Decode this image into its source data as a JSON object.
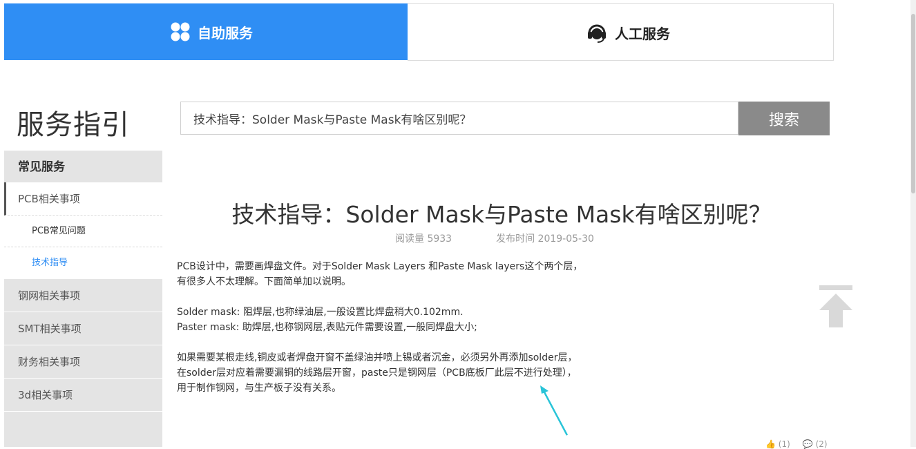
{
  "tabs": {
    "self_service": "自助服务",
    "human_service": "人工服务"
  },
  "sidebar": {
    "guide_title": "服务指引",
    "header": "常见服务",
    "items": [
      {
        "label": "PCB相关事项",
        "active": true
      },
      {
        "label": "PCB常见问题",
        "sub": true
      },
      {
        "label": "技术指导",
        "sub": true,
        "current": true
      },
      {
        "label": "钢网相关事项"
      },
      {
        "label": "SMT相关事项"
      },
      {
        "label": "财务相关事项"
      },
      {
        "label": "3d相关事项"
      }
    ]
  },
  "search": {
    "value": "技术指导：Solder Mask与Paste Mask有啥区别呢？",
    "button_label": "搜索"
  },
  "article": {
    "title": "技术指导：Solder Mask与Paste Mask有啥区别呢？",
    "views_label": "阅读量 5933",
    "date_label": "发布时间 2019-05-30",
    "lines": [
      "PCB设计中，需要画焊盘文件。对于Solder Mask Layers 和Paste Mask layers这个两个层，",
      "有很多人不太理解。下面简单加以说明。",
      "",
      "Solder mask: 阻焊层,也称绿油层,一般设置比焊盘稍大0.102mm.",
      "Paster mask: 助焊层,也称钢网层,表贴元件需要设置,一般同焊盘大小;",
      "",
      "如果需要某根走线,铜皮或者焊盘开窗不盖绿油并喷上锡或者沉金，必须另外再添加solder层，",
      "在solder层对应着需要漏铜的线路层开窗，paste只是钢网层（PCB底板厂此层不进行处理），",
      "用于制作钢网，与生产板子没有关系。"
    ]
  },
  "reactions": {
    "like_count": "(1)",
    "comment_count": "(2)"
  },
  "colors": {
    "accent": "#2f8ef4",
    "search_button": "#8a8a8a",
    "sidebar_bg": "#e4e4e4",
    "annotation_arrow": "#29c4d8"
  }
}
